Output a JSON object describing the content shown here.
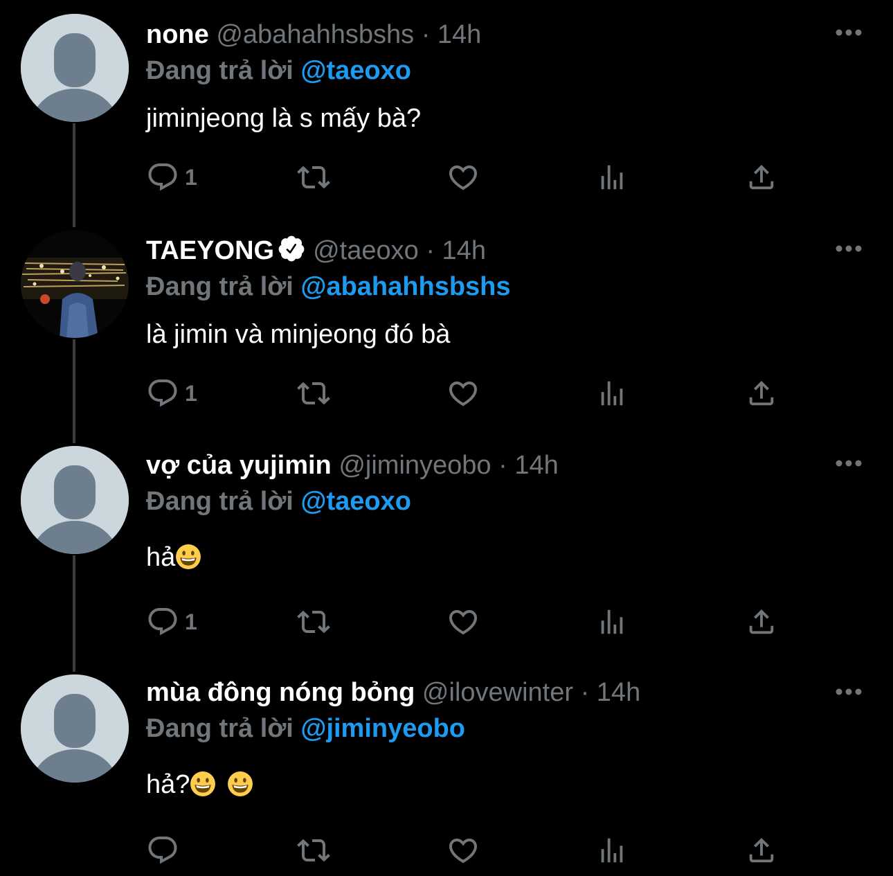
{
  "colors": {
    "background": "#000000",
    "text_primary": "#ffffff",
    "text_secondary": "#71767b",
    "accent": "#1d9bf0",
    "thread_line": "#3a3d40",
    "avatar_default_bg": "#ccd6dd",
    "avatar_default_fg": "#6d7f8f"
  },
  "icons": {
    "reply": "speech-bubble-icon",
    "retweet": "retweet-icon",
    "like": "heart-icon",
    "views": "bar-chart-icon",
    "share": "share-upload-icon",
    "more": "three-dots-icon",
    "verified": "verified-badge-icon"
  },
  "tweets": [
    {
      "display_name": "none",
      "handle": "@abahahhsbshs",
      "separator": "·",
      "time": "14h",
      "reply_prefix": "Đang trả lời",
      "reply_to": "@taeoxo",
      "text": "jiminjeong là s mấy bà?",
      "reply_count": "1",
      "verified": false,
      "avatar": "default"
    },
    {
      "display_name": "TAEYONG",
      "handle": "@taeoxo",
      "separator": "·",
      "time": "14h",
      "reply_prefix": "Đang trả lời",
      "reply_to": "@abahahhsbshs",
      "text": "là jimin và minjeong đó bà",
      "reply_count": "1",
      "verified": true,
      "avatar": "photo"
    },
    {
      "display_name": "vợ của yujimin",
      "handle": "@jiminyeobo",
      "separator": "·",
      "time": "14h",
      "reply_prefix": "Đang trả lời",
      "reply_to": "@taeoxo",
      "text": "hả",
      "emojis": [
        "grinning-face-emoji"
      ],
      "reply_count": "1",
      "verified": false,
      "avatar": "default"
    },
    {
      "display_name": "mùa đông nóng bỏng",
      "handle": "@ilovewinter",
      "separator": "·",
      "time": "14h",
      "reply_prefix": "Đang trả lời",
      "reply_to": "@jiminyeobo",
      "text": "hả?",
      "emojis": [
        "grinning-face-emoji",
        "grinning-face-emoji"
      ],
      "reply_count": "",
      "verified": false,
      "avatar": "default"
    }
  ]
}
